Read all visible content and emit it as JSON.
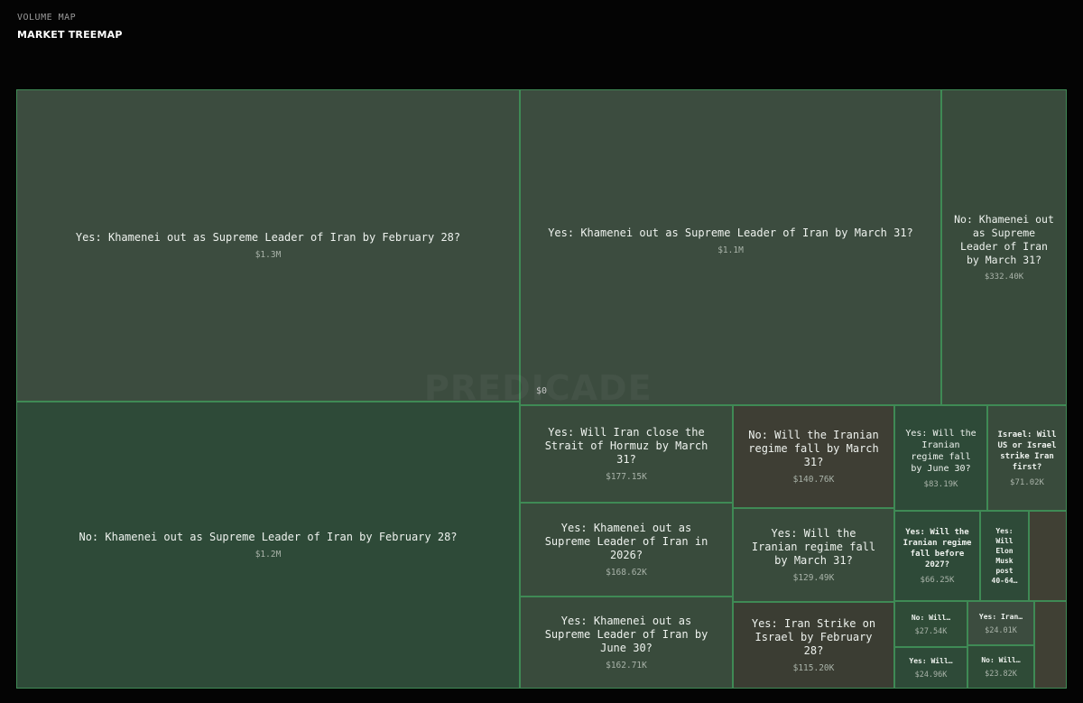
{
  "header": {
    "subtitle": "VOLUME MAP",
    "title": "MARKET TREEMAP"
  },
  "watermark": "PREDICADE",
  "axis_zero": "$0",
  "colors": {
    "background": "#040404",
    "cell_border": "#3f8a55",
    "yes_green": "#394b3c",
    "no_brown": "#3e3e34"
  },
  "markets": [
    {
      "label": "Yes: Khamenei out as Supreme Leader of Iran by February 28?",
      "volume": "$1.3M"
    },
    {
      "label": "Yes: Khamenei out as Supreme Leader of Iran by March 31?",
      "volume": "$1.1M"
    },
    {
      "label": "No: Khamenei out as Supreme Leader of Iran by March 31?",
      "volume": "$332.40K"
    },
    {
      "label": "No: Khamenei out as Supreme Leader of Iran by February 28?",
      "volume": "$1.2M"
    },
    {
      "label": "Yes: Will Iran close the Strait of Hormuz by March 31?",
      "volume": "$177.15K"
    },
    {
      "label": "No: Will the Iranian regime fall by March 31?",
      "volume": "$140.76K"
    },
    {
      "label": "Yes: Will the Iranian regime fall by June 30?",
      "volume": "$83.19K"
    },
    {
      "label": "Israel: Will US or Israel strike Iran first?",
      "volume": "$71.02K"
    },
    {
      "label": "Yes: Khamenei out as Supreme Leader of Iran in 2026?",
      "volume": "$168.62K"
    },
    {
      "label": "Yes: Will the Iranian regime fall by March 31?",
      "volume": "$129.49K"
    },
    {
      "label": "Yes: Will the Iranian regime fall before 2027?",
      "volume": "$66.25K"
    },
    {
      "label": "Yes: Will Elon Musk post 40-64…",
      "volume": ""
    },
    {
      "label": "Yes: Khamenei out as Supreme Leader of Iran by June 30?",
      "volume": "$162.71K"
    },
    {
      "label": "Yes: Iran Strike on Israel by February 28?",
      "volume": "$115.20K"
    },
    {
      "label": "No: Will…",
      "volume": "$27.54K"
    },
    {
      "label": "Yes: Iran…",
      "volume": "$24.01K"
    },
    {
      "label": "Yes: Will…",
      "volume": "$24.96K"
    },
    {
      "label": "No: Will…",
      "volume": "$23.82K"
    },
    {
      "label": "",
      "volume": ""
    },
    {
      "label": "",
      "volume": ""
    }
  ]
}
